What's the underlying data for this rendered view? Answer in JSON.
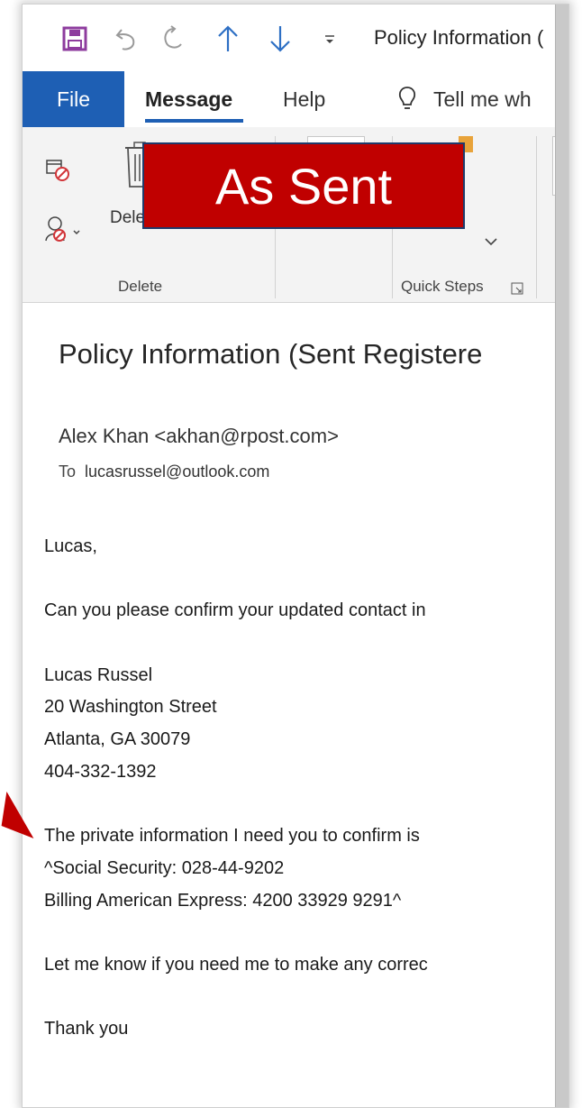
{
  "quick_access": {
    "icons": [
      "save-icon",
      "undo-icon",
      "redo-icon",
      "arrow-up-icon",
      "arrow-down-icon",
      "customize-icon"
    ],
    "title": "Policy Information ("
  },
  "tabs": {
    "file": "File",
    "message": "Message",
    "help": "Help",
    "tell_me": "Tell me wh"
  },
  "ribbon": {
    "delete_button": "Delet",
    "delete_group": "Delete",
    "quick_steps_group": "Quick Steps",
    "partial_label": "M"
  },
  "banner": {
    "text": "As Sent",
    "color": "#c00000"
  },
  "message": {
    "subject": "Policy Information (Sent Registere",
    "from": "Alex Khan <akhan@rpost.com>",
    "to_label": "To",
    "to_value": "lucasrussel@outlook.com",
    "body_lines": [
      "Lucas,",
      "",
      "Can you please confirm your updated contact in",
      "",
      "Lucas Russel",
      "20 Washington Street",
      "Atlanta, GA 30079",
      "404-332-1392",
      "",
      "The private information I need you to confirm is",
      "^Social Security: 028-44-9202",
      "Billing American Express: 4200 33929 9291^",
      "",
      "Let me know if you need me to make any correc",
      "",
      "Thank you"
    ]
  },
  "colors": {
    "accent": "#1e5fb4",
    "banner": "#c00000",
    "save_icon": "#8e3c9e"
  }
}
